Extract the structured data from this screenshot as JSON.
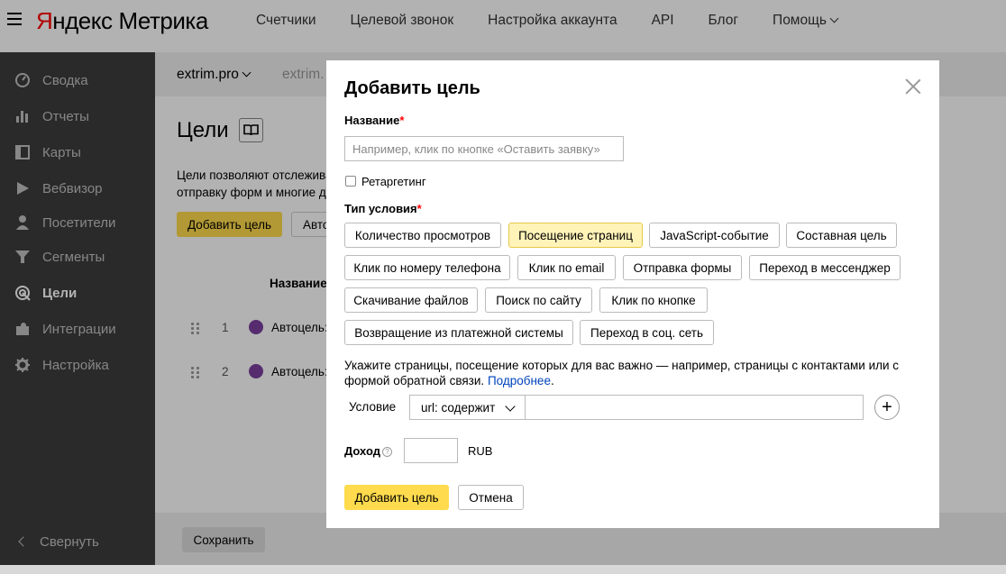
{
  "header": {
    "logo_brand_first": "Я",
    "logo_brand_rest": "ндекс",
    "logo_product": "Метрика",
    "nav": [
      "Счетчики",
      "Целевой звонок",
      "Настройка аккаунта",
      "API",
      "Блог",
      "Помощь"
    ]
  },
  "sidebar": {
    "items": [
      {
        "label": "Сводка",
        "icon": "gauge-icon"
      },
      {
        "label": "Отчеты",
        "icon": "bar-chart-icon"
      },
      {
        "label": "Карты",
        "icon": "map-icon"
      },
      {
        "label": "Вебвизор",
        "icon": "play-icon"
      },
      {
        "label": "Посетители",
        "icon": "user-icon"
      },
      {
        "label": "Сегменты",
        "icon": "funnel-icon"
      },
      {
        "label": "Цели",
        "icon": "target-icon"
      },
      {
        "label": "Интеграции",
        "icon": "puzzle-icon"
      },
      {
        "label": "Настройка",
        "icon": "gear-icon"
      }
    ],
    "active": "Цели",
    "collapse_label": "Свернуть"
  },
  "page": {
    "site_selector": "extrim.pro",
    "site_selector_2": "extrim.",
    "title": "Цели",
    "description_line1": "Цели позволяют отслежива",
    "description_line2": "отправку форм и многие др",
    "add_goal_label": "Добавить цель",
    "auto_label": "Авто",
    "table_header_name": "Название",
    "rows": [
      {
        "num": "1",
        "label": "Автоцель:"
      },
      {
        "num": "2",
        "label": "Автоцель:"
      }
    ],
    "save_label": "Сохранить"
  },
  "modal": {
    "title": "Добавить цель",
    "name_label": "Название",
    "required_mark": "*",
    "name_placeholder": "Например, клик по кнопке «Оставить заявку»",
    "retargeting_label": "Ретаргетинг",
    "condition_type_label": "Тип условия",
    "condition_types": [
      "Количество просмотров",
      "Посещение страниц",
      "JavaScript-событие",
      "Составная цель",
      "Клик по номеру телефона",
      "Клик по email",
      "Отправка формы",
      "Переход в мессенджер",
      "Скачивание файлов",
      "Поиск по сайту",
      "Клик по кнопке",
      "Возвращение из платежной системы",
      "Переход в соц. сеть"
    ],
    "selected_condition_type": "Посещение страниц",
    "hint_text": "Укажите страницы, посещение которых для вас важно — например, страницы с контактами или с формой обратной связи.",
    "hint_link": "Подробнее",
    "condition_label": "Условие",
    "condition_select_value": "url: содержит",
    "condition_value": "",
    "income_label": "Доход",
    "income_help": "?",
    "income_value": "",
    "currency": "RUB",
    "submit_label": "Добавить цель",
    "cancel_label": "Отмена"
  },
  "colors": {
    "accent_yellow": "#ffdb4d",
    "selected_chip": "#fff3b8",
    "sidebar_bg": "#3d3d3d",
    "logo_red": "#ff0000",
    "link": "#0044bb"
  }
}
